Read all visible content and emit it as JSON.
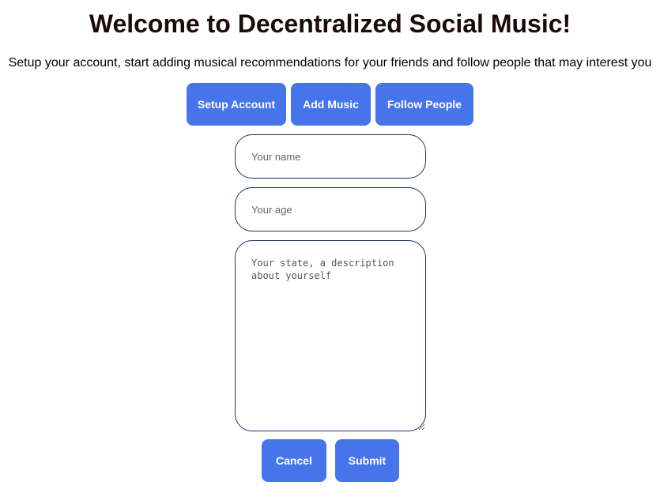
{
  "header": {
    "title": "Welcome to Decentralized Social Music!",
    "subtitle": "Setup your account, start adding musical recommendations for your friends and follow people that may interest you"
  },
  "nav": {
    "setup_label": "Setup Account",
    "add_music_label": "Add Music",
    "follow_label": "Follow People"
  },
  "form": {
    "name_placeholder": "Your name",
    "age_placeholder": "Your age",
    "description_placeholder": "Your state, a description about yourself",
    "name_value": "",
    "age_value": "",
    "description_value": ""
  },
  "actions": {
    "cancel_label": "Cancel",
    "submit_label": "Submit"
  },
  "colors": {
    "accent": "#4674eb",
    "field_border": "#1e3264"
  }
}
